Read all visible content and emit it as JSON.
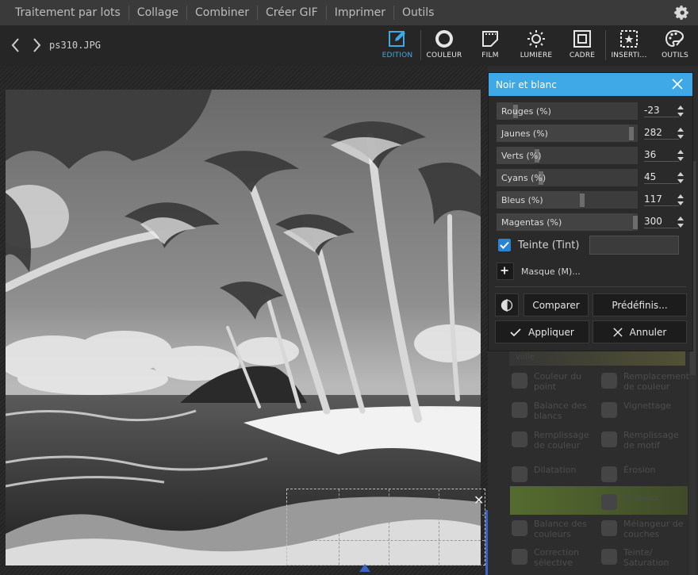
{
  "menu": {
    "items": [
      "Traitement par lots",
      "Collage",
      "Combiner",
      "Créer GIF",
      "Imprimer",
      "Outils"
    ],
    "settings_icon": "gear-icon"
  },
  "toolbar": {
    "filename": "ps310.JPG",
    "tools": [
      {
        "label": "EDITION",
        "icon": "edit-icon",
        "active": true
      },
      {
        "label": "COULEUR",
        "icon": "color-circle-icon"
      },
      {
        "label": "FILM",
        "icon": "film-icon"
      },
      {
        "label": "LUMIÈRE",
        "icon": "sun-icon"
      },
      {
        "label": "CADRE",
        "icon": "frame-icon"
      },
      {
        "label": "INSERTI...",
        "icon": "insert-star-icon"
      },
      {
        "label": "OUTILS",
        "icon": "palette-icon"
      }
    ],
    "accent_color": "#3fa9e8"
  },
  "dialog": {
    "title": "Noir et blanc",
    "sliders": [
      {
        "label": "Rouges (%)",
        "value": "-23",
        "level": 0.12
      },
      {
        "label": "Jaunes (%)",
        "value": "282",
        "level": 0.97
      },
      {
        "label": "Verts (%)",
        "value": "36",
        "level": 0.28
      },
      {
        "label": "Cyans (%)",
        "value": "45",
        "level": 0.31
      },
      {
        "label": "Bleus (%)",
        "value": "117",
        "level": 0.61
      },
      {
        "label": "Magentas (%)",
        "value": "300",
        "level": 1.0
      }
    ],
    "tint_label": "Teinte (Tint)",
    "tint_checked": true,
    "mask_label": "Masque (M)...",
    "compare_label": "Comparer",
    "presets_label": "Prédéfinis...",
    "apply_label": "Appliquer",
    "cancel_label": "Annuler"
  },
  "side_panel": {
    "items": [
      "voile",
      "Couleur du point",
      "Remplacement de couleur",
      "Balance des blancs",
      "Vignettage",
      "Remplissage de couleur",
      "Remplissage de motif",
      "Dilatation",
      "Érosion",
      "Niveaux",
      "Balance des couleurs",
      "Mélangeur de couches",
      "Correction sélective",
      "Teinte/ Saturation"
    ]
  }
}
